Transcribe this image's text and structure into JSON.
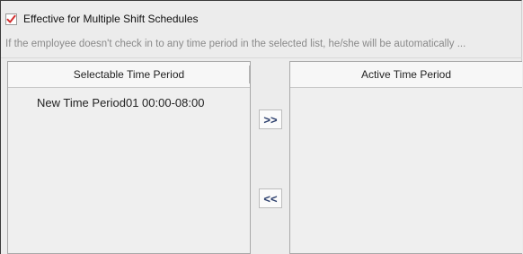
{
  "checkbox": {
    "label": "Effective for Multiple Shift Schedules",
    "checked": true
  },
  "hint_text": "If the employee doesn't check in to any time period in the selected list, he/she will be automatically ...",
  "selectable_panel": {
    "header": "Selectable Time Period",
    "items": [
      "New Time Period01 00:00-08:00"
    ]
  },
  "active_panel": {
    "header": "Active Time Period",
    "items": []
  },
  "buttons": {
    "add_label": ">>",
    "remove_label": "<<"
  },
  "colors": {
    "check_mark": "#d32f2f",
    "button_text": "#2a3d6b",
    "hint_text": "#8a8a8a"
  }
}
